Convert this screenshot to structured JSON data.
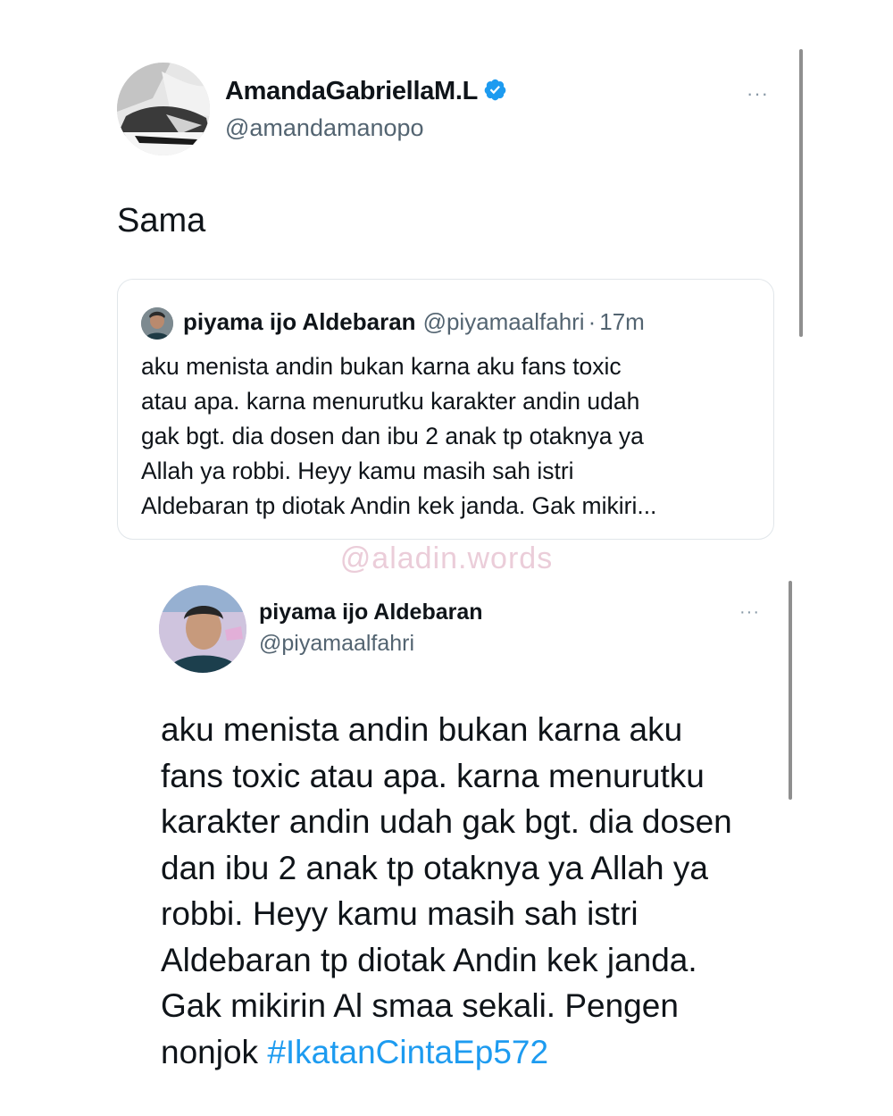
{
  "tweet": {
    "display_name": "AmandaGabriellaM.L",
    "handle": "@amandamanopo",
    "verified": true,
    "more_label": "···",
    "text": "Sama"
  },
  "quoted_tweet": {
    "display_name": "piyama ijo Aldebaran",
    "handle": "@piyamaalfahri",
    "separator": "·",
    "time": "17m",
    "text": "aku menista andin bukan karna aku fans toxic\natau apa. karna menurutku karakter andin udah\ngak bgt. dia dosen dan ibu 2 anak tp otaknya ya\nAllah ya robbi. Heyy kamu masih sah istri\nAldebaran tp diotak Andin kek janda. Gak mikiri..."
  },
  "watermark": "@aladin.words",
  "expanded_tweet": {
    "display_name": "piyama ijo Aldebaran",
    "handle": "@piyamaalfahri",
    "more_label": "···",
    "lines": [
      "aku menista andin bukan karna aku",
      "fans toxic atau apa. karna menurutku",
      "karakter andin udah gak bgt. dia dosen",
      "dan ibu 2 anak tp otaknya ya Allah ya",
      "robbi. Heyy kamu masih sah istri",
      "Aldebaran tp diotak Andin kek janda.",
      "Gak mikirin Al smaa sekali. Pengen"
    ],
    "last_line_prefix": "nonjok ",
    "hashtag": "#IkatanCintaEp572"
  },
  "colors": {
    "verified_badge": "#1d9bf0",
    "hashtag": "#1d9bf0",
    "secondary_text": "#536471",
    "watermark": "#ebcdd9"
  }
}
